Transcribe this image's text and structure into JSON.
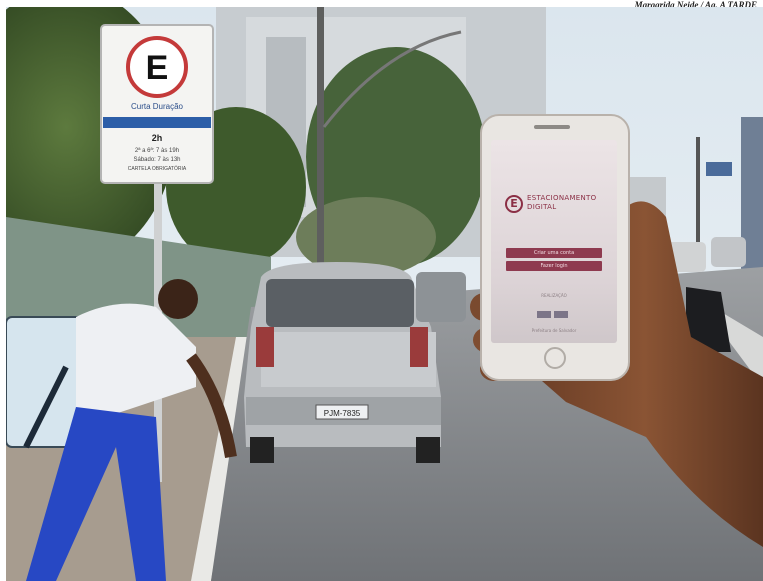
{
  "photo_credit": "Margarida Neide / Ag. A TARDE",
  "street_sign": {
    "letter": "E",
    "zone": "Curta Duração",
    "hours": "2h",
    "lines": [
      "2ª a 6ª: 7 às 19h",
      "Sábado: 7 às 13h",
      "CARTELA OBRIGATÓRIA"
    ]
  },
  "phone_app": {
    "logo_letter": "E",
    "title_line1": "ESTACIONAMENTO",
    "title_line2": "DIGITAL",
    "button_primary": "Criar uma conta",
    "button_secondary": "Fazer login",
    "footer_label": "REALIZAÇÃO",
    "footer_note": "Prefeitura de Salvador"
  },
  "license_plate": "PJM-7835",
  "colors": {
    "app_accent": "#8e3a4f",
    "sky": "#dfe9ef",
    "car": "#b9bcbf"
  }
}
